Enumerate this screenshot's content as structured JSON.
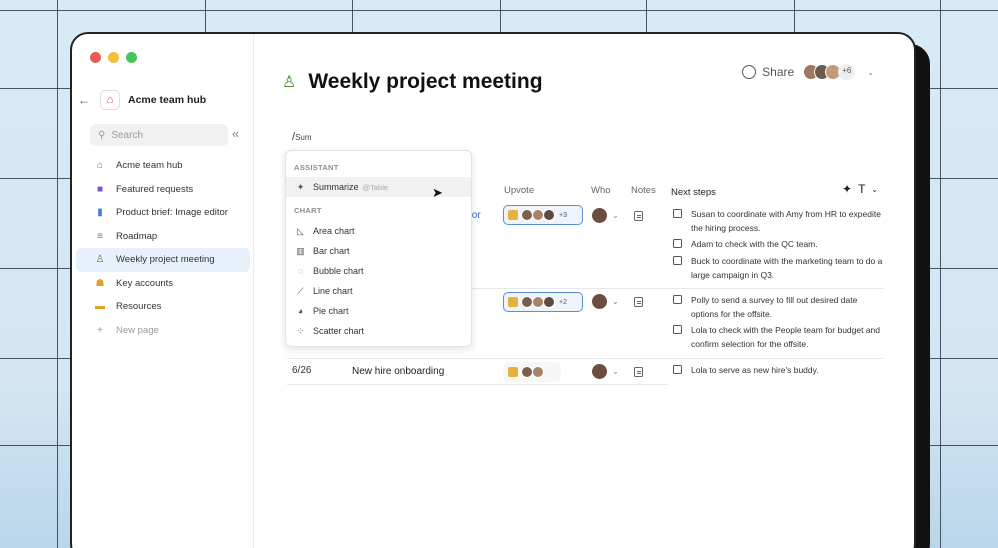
{
  "window": {
    "hub_title": "Acme team hub",
    "search_placeholder": "Search"
  },
  "sidebar": {
    "items": [
      {
        "label": "Acme team hub",
        "icon": "house-icon",
        "color": "#d24a3a"
      },
      {
        "label": "Featured requests",
        "icon": "chat-icon",
        "color": "#7a4fd0"
      },
      {
        "label": "Product brief: Image editor",
        "icon": "doc-icon",
        "color": "#3b82d6"
      },
      {
        "label": "Roadmap",
        "icon": "roadmap-icon",
        "color": "#3b82d6"
      },
      {
        "label": "Weekly project meeting",
        "icon": "people-icon",
        "color": "#4a8a3a",
        "active": true
      },
      {
        "label": "Key accounts",
        "icon": "accounts-icon",
        "color": "#e0a030"
      },
      {
        "label": "Resources",
        "icon": "box-icon",
        "color": "#d9a52e"
      },
      {
        "label": "New page",
        "icon": "plus-icon",
        "color": "#999999"
      }
    ]
  },
  "page": {
    "title": "Weekly project meeting",
    "share_label": "Share",
    "share_count": "+6",
    "slash_command": "/",
    "slash_query": "Sum"
  },
  "dropdown": {
    "assistant_section": "ASSISTANT",
    "summarize_label": "Summarize",
    "summarize_hint": "@Table",
    "chart_section": "CHART",
    "chart_items": [
      {
        "label": "Area chart",
        "icon": "area-chart-icon"
      },
      {
        "label": "Bar chart",
        "icon": "bar-chart-icon"
      },
      {
        "label": "Bubble chart",
        "icon": "bubble-chart-icon"
      },
      {
        "label": "Line chart",
        "icon": "line-chart-icon"
      },
      {
        "label": "Pie chart",
        "icon": "pie-chart-icon"
      },
      {
        "label": "Scatter chart",
        "icon": "scatter-chart-icon"
      }
    ]
  },
  "table": {
    "headers": {
      "upvote": "Upvote",
      "who": "Who",
      "notes": "Notes",
      "next_steps": "Next steps"
    },
    "rows": [
      {
        "date": "",
        "topic": "tor",
        "upvote_count": "+3",
        "steps": [
          "Susan to coordinate with Amy from HR to expedite the hiring process.",
          "Adam to check with the QC team.",
          "Buck to coordinate with the marketing team to do a large campaign in Q3."
        ]
      },
      {
        "date": "",
        "topic": "",
        "upvote_count": "+2",
        "steps": [
          "Polly to send a survey to fill out desired date options for the offsite.",
          "Lola to check with the People team for budget and confirm selection for the offsite."
        ]
      },
      {
        "date": "6/26",
        "topic": "New hire onboarding",
        "upvote_count": "",
        "steps": [
          "Lola to serve as new hire's buddy."
        ]
      }
    ]
  }
}
